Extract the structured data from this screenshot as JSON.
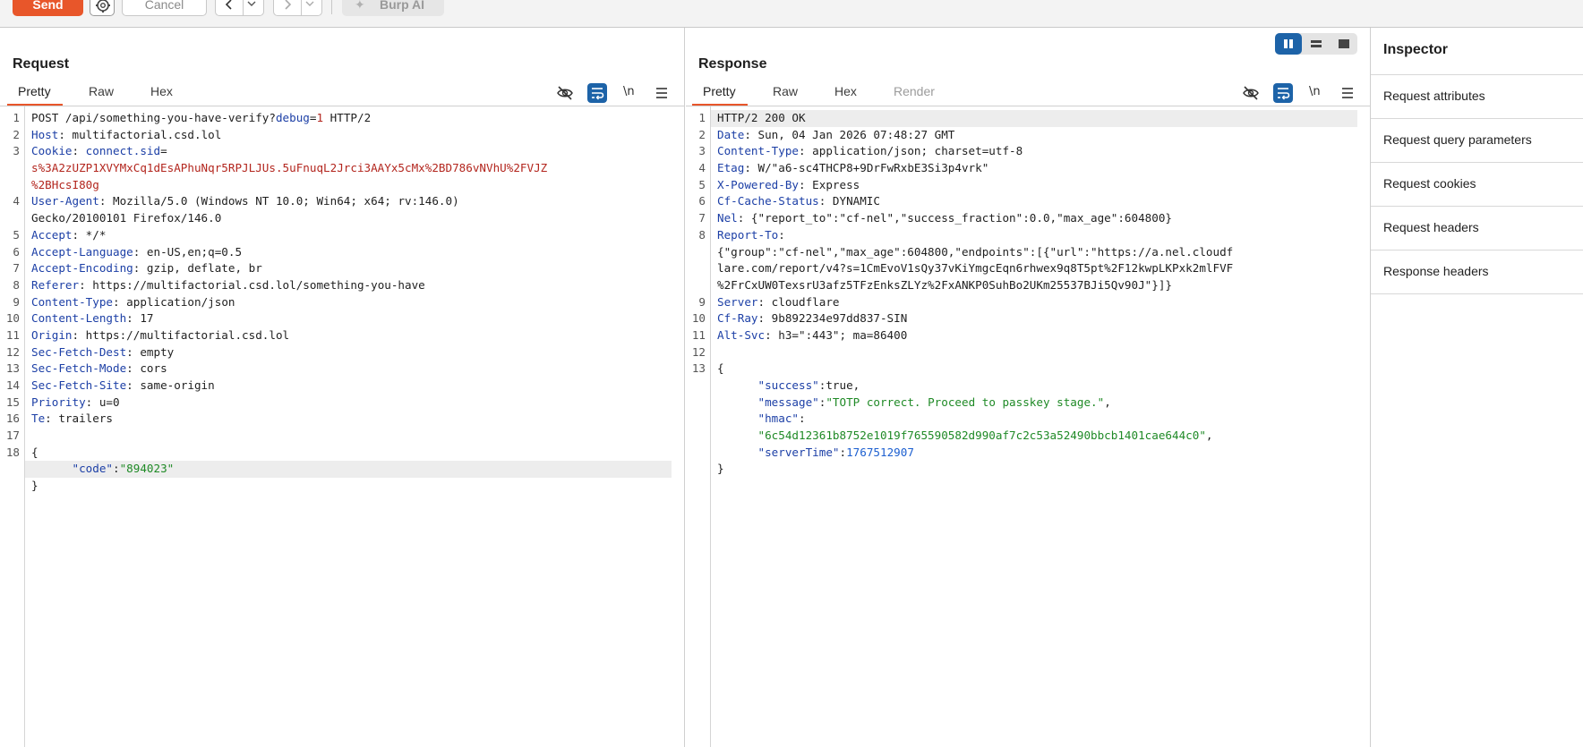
{
  "toolbar": {
    "send_label": "Send",
    "cancel_label": "Cancel",
    "burp_ai_label": "Burp AI",
    "accent_color": "#e8562a"
  },
  "request": {
    "title": "Request",
    "tabs": [
      "Pretty",
      "Raw",
      "Hex"
    ],
    "active_tab": "Pretty",
    "newline_toggle": "\\n",
    "lines": [
      {
        "n": "1",
        "parts": [
          [
            "v",
            "POST /api/something-you-have-verify?"
          ],
          [
            "k",
            "debug"
          ],
          [
            "v",
            "="
          ],
          [
            "cv",
            "1"
          ],
          [
            "v",
            " HTTP/2"
          ]
        ]
      },
      {
        "n": "2",
        "parts": [
          [
            "k",
            "Host"
          ],
          [
            "v",
            ": multifactorial.csd.lol"
          ]
        ]
      },
      {
        "n": "3",
        "parts": [
          [
            "k",
            "Cookie"
          ],
          [
            "v",
            ": "
          ],
          [
            "ck",
            "connect.sid"
          ],
          [
            "v",
            "="
          ]
        ]
      },
      {
        "n": "",
        "parts": [
          [
            "cv",
            "s%3A2zUZP1XVYMxCq1dEsAPhuNqr5RPJLJUs.5uFnuqL2Jrci3AAYx5cMx%2BD786vNVhU%2FVJZ"
          ]
        ]
      },
      {
        "n": "",
        "parts": [
          [
            "cv",
            "%2BHcsI80g"
          ]
        ]
      },
      {
        "n": "4",
        "parts": [
          [
            "k",
            "User-Agent"
          ],
          [
            "v",
            ": Mozilla/5.0 (Windows NT 10.0; Win64; x64; rv:146.0)"
          ]
        ]
      },
      {
        "n": "",
        "parts": [
          [
            "v",
            "Gecko/20100101 Firefox/146.0"
          ]
        ]
      },
      {
        "n": "5",
        "parts": [
          [
            "k",
            "Accept"
          ],
          [
            "v",
            ": */*"
          ]
        ]
      },
      {
        "n": "6",
        "parts": [
          [
            "k",
            "Accept-Language"
          ],
          [
            "v",
            ": en-US,en;q=0.5"
          ]
        ]
      },
      {
        "n": "7",
        "parts": [
          [
            "k",
            "Accept-Encoding"
          ],
          [
            "v",
            ": gzip, deflate, br"
          ]
        ]
      },
      {
        "n": "8",
        "parts": [
          [
            "k",
            "Referer"
          ],
          [
            "v",
            ": https://multifactorial.csd.lol/something-you-have"
          ]
        ]
      },
      {
        "n": "9",
        "parts": [
          [
            "k",
            "Content-Type"
          ],
          [
            "v",
            ": application/json"
          ]
        ]
      },
      {
        "n": "10",
        "parts": [
          [
            "k",
            "Content-Length"
          ],
          [
            "v",
            ": 17"
          ]
        ]
      },
      {
        "n": "11",
        "parts": [
          [
            "k",
            "Origin"
          ],
          [
            "v",
            ": https://multifactorial.csd.lol"
          ]
        ]
      },
      {
        "n": "12",
        "parts": [
          [
            "k",
            "Sec-Fetch-Dest"
          ],
          [
            "v",
            ": empty"
          ]
        ]
      },
      {
        "n": "13",
        "parts": [
          [
            "k",
            "Sec-Fetch-Mode"
          ],
          [
            "v",
            ": cors"
          ]
        ]
      },
      {
        "n": "14",
        "parts": [
          [
            "k",
            "Sec-Fetch-Site"
          ],
          [
            "v",
            ": same-origin"
          ]
        ]
      },
      {
        "n": "15",
        "parts": [
          [
            "k",
            "Priority"
          ],
          [
            "v",
            ": u=0"
          ]
        ]
      },
      {
        "n": "16",
        "parts": [
          [
            "k",
            "Te"
          ],
          [
            "v",
            ": trailers"
          ]
        ]
      },
      {
        "n": "17",
        "parts": []
      },
      {
        "n": "18",
        "parts": [
          [
            "jb",
            "{"
          ]
        ]
      },
      {
        "n": "",
        "hl": true,
        "parts": [
          [
            "jb",
            "      "
          ],
          [
            "js",
            "\"code\""
          ],
          [
            "jb",
            ":"
          ],
          [
            "jsv",
            "\"894023\""
          ]
        ]
      },
      {
        "n": "",
        "parts": [
          [
            "jb",
            "}"
          ]
        ]
      }
    ]
  },
  "response": {
    "title": "Response",
    "tabs": [
      "Pretty",
      "Raw",
      "Hex",
      "Render"
    ],
    "active_tab": "Pretty",
    "newline_toggle": "\\n",
    "lines": [
      {
        "n": "1",
        "hl": true,
        "parts": [
          [
            "v",
            "HTTP/2 200 OK"
          ]
        ]
      },
      {
        "n": "2",
        "parts": [
          [
            "k",
            "Date"
          ],
          [
            "v",
            ": Sun, 04 Jan 2026 07:48:27 GMT"
          ]
        ]
      },
      {
        "n": "3",
        "parts": [
          [
            "k",
            "Content-Type"
          ],
          [
            "v",
            ": application/json; charset=utf-8"
          ]
        ]
      },
      {
        "n": "4",
        "parts": [
          [
            "k",
            "Etag"
          ],
          [
            "v",
            ": W/\"a6-sc4THCP8+9DrFwRxbE3Si3p4vrk\""
          ]
        ]
      },
      {
        "n": "5",
        "parts": [
          [
            "k",
            "X-Powered-By"
          ],
          [
            "v",
            ": Express"
          ]
        ]
      },
      {
        "n": "6",
        "parts": [
          [
            "k",
            "Cf-Cache-Status"
          ],
          [
            "v",
            ": DYNAMIC"
          ]
        ]
      },
      {
        "n": "7",
        "parts": [
          [
            "k",
            "Nel"
          ],
          [
            "v",
            ": {\"report_to\":\"cf-nel\",\"success_fraction\":0.0,\"max_age\":604800}"
          ]
        ]
      },
      {
        "n": "8",
        "parts": [
          [
            "k",
            "Report-To"
          ],
          [
            "v",
            ":"
          ]
        ]
      },
      {
        "n": "",
        "parts": [
          [
            "v",
            "{\"group\":\"cf-nel\",\"max_age\":604800,\"endpoints\":[{\"url\":\"https://a.nel.cloudf"
          ]
        ]
      },
      {
        "n": "",
        "parts": [
          [
            "v",
            "lare.com/report/v4?s=1CmEvoV1sQy37vKiYmgcEqn6rhwex9q8T5pt%2F12kwpLKPxk2mlFVF"
          ]
        ]
      },
      {
        "n": "",
        "parts": [
          [
            "v",
            "%2FrCxUW0TexsrU3afz5TFzEnksZLYz%2FxANKP0SuhBo2UKm25537BJi5Qv90J\"}]}"
          ]
        ]
      },
      {
        "n": "9",
        "parts": [
          [
            "k",
            "Server"
          ],
          [
            "v",
            ": cloudflare"
          ]
        ]
      },
      {
        "n": "10",
        "parts": [
          [
            "k",
            "Cf-Ray"
          ],
          [
            "v",
            ": 9b892234e97dd837-SIN"
          ]
        ]
      },
      {
        "n": "11",
        "parts": [
          [
            "k",
            "Alt-Svc"
          ],
          [
            "v",
            ": h3=\":443\"; ma=86400"
          ]
        ]
      },
      {
        "n": "12",
        "parts": []
      },
      {
        "n": "13",
        "parts": [
          [
            "jb",
            "{"
          ]
        ]
      },
      {
        "n": "",
        "parts": [
          [
            "jb",
            "      "
          ],
          [
            "js",
            "\"success\""
          ],
          [
            "jb",
            ":true,"
          ]
        ]
      },
      {
        "n": "",
        "parts": [
          [
            "jb",
            "      "
          ],
          [
            "js",
            "\"message\""
          ],
          [
            "jb",
            ":"
          ],
          [
            "jsv",
            "\"TOTP correct. Proceed to passkey stage.\""
          ],
          [
            "jb",
            ","
          ]
        ]
      },
      {
        "n": "",
        "parts": [
          [
            "jb",
            "      "
          ],
          [
            "js",
            "\"hmac\""
          ],
          [
            "jb",
            ":"
          ]
        ]
      },
      {
        "n": "",
        "parts": [
          [
            "jb",
            "      "
          ],
          [
            "jsv",
            "\"6c54d12361b8752e1019f765590582d990af7c2c53a52490bbcb1401cae644c0\""
          ],
          [
            "jb",
            ","
          ]
        ]
      },
      {
        "n": "",
        "parts": [
          [
            "jb",
            "      "
          ],
          [
            "js",
            "\"serverTime\""
          ],
          [
            "jb",
            ":"
          ],
          [
            "jn",
            "1767512907"
          ]
        ]
      },
      {
        "n": "",
        "parts": [
          [
            "jb",
            "}"
          ]
        ]
      }
    ]
  },
  "inspector": {
    "title": "Inspector",
    "items": [
      "Request attributes",
      "Request query parameters",
      "Request cookies",
      "Request headers",
      "Response headers"
    ]
  }
}
